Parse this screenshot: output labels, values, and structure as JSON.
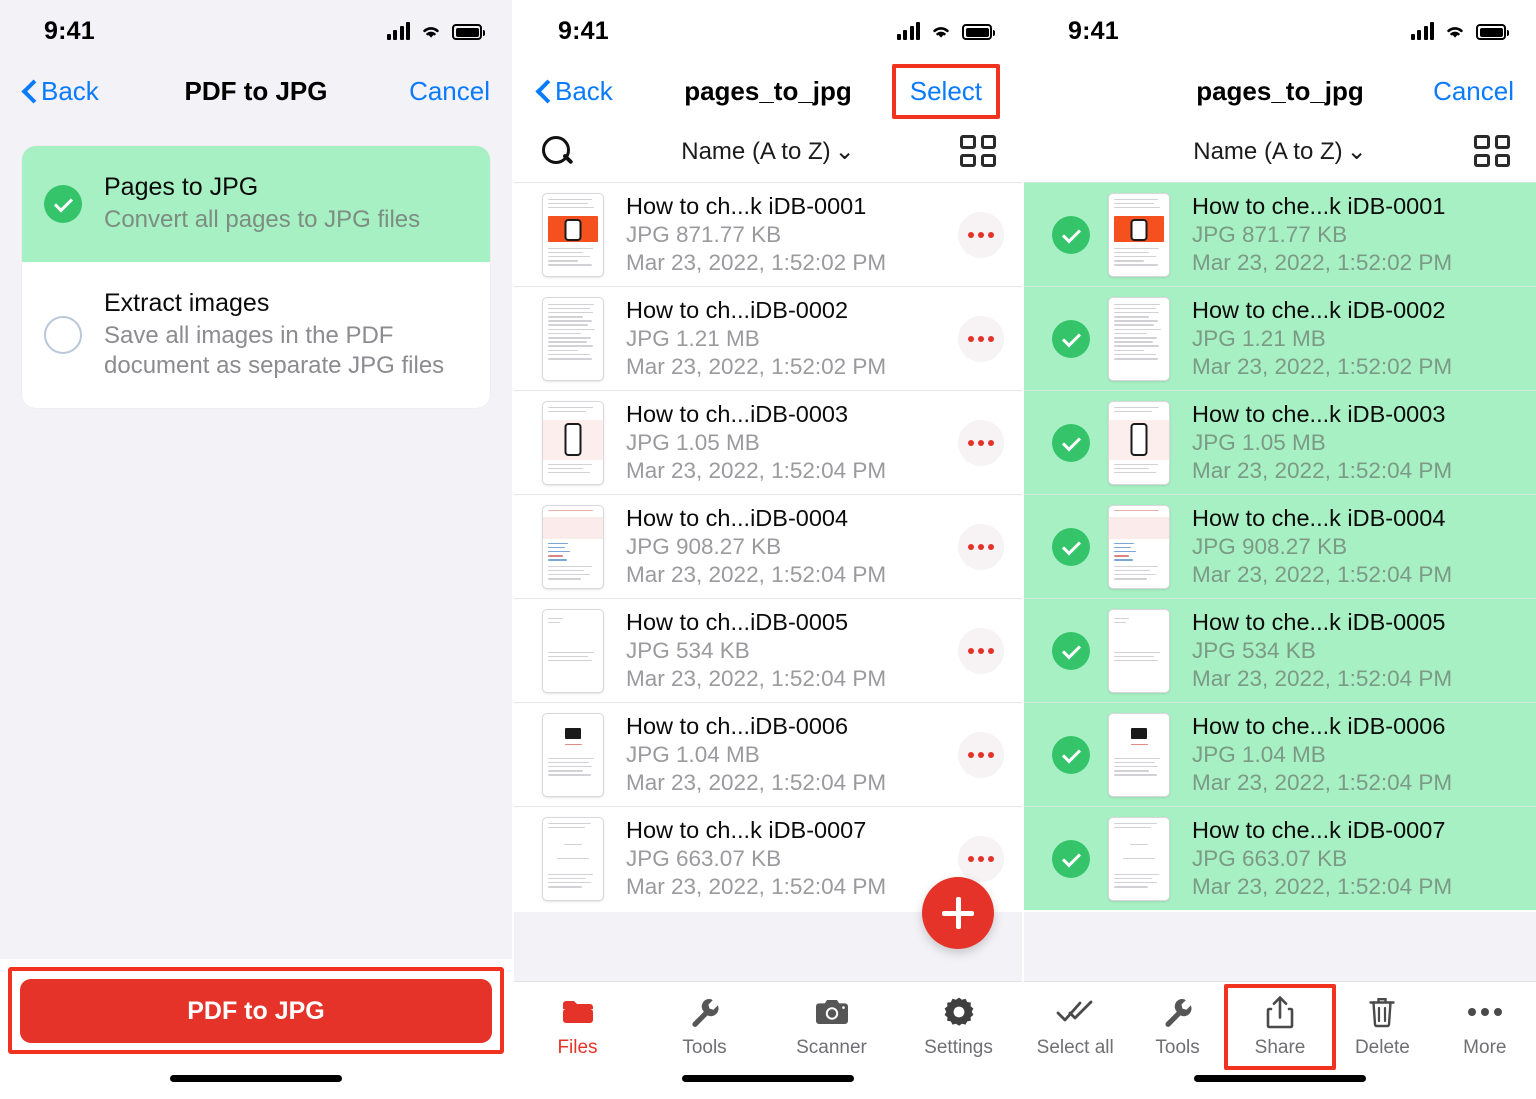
{
  "colors": {
    "accent_red": "#e5332a",
    "highlight_box": "#f0321e",
    "ios_blue": "#0a7bff",
    "select_green_bg": "#a7f0c3",
    "check_green": "#35c46a",
    "panel_bg": "#f2f2f7"
  },
  "status_bar": {
    "time": "9:41",
    "signal_icon": "cellular-bars-icon",
    "wifi_icon": "wifi-icon",
    "battery_icon": "battery-full-icon"
  },
  "panel1": {
    "nav": {
      "back_label": "Back",
      "title": "PDF to JPG",
      "right_label": "Cancel"
    },
    "options": [
      {
        "title": "Pages to JPG",
        "subtitle": "Convert all pages to JPG files",
        "selected": true
      },
      {
        "title": "Extract images",
        "subtitle": "Save all images in the PDF document as separate JPG files",
        "selected": false
      }
    ],
    "cta_label": "PDF to JPG"
  },
  "panel2": {
    "nav": {
      "back_label": "Back",
      "title": "pages_to_jpg",
      "right_label": "Select",
      "right_highlighted": true
    },
    "toolbar": {
      "search_icon": "search-icon",
      "sort_label": "Name (A to Z)",
      "sort_chevron": "⌄",
      "grid_icon": "grid-view-icon"
    },
    "files": [
      {
        "name": "How to ch...k iDB-0001",
        "meta": "JPG 871.77 KB",
        "date": "Mar 23, 2022, 1:52:02 PM"
      },
      {
        "name": "How to ch...iDB-0002",
        "meta": "JPG 1.21 MB",
        "date": "Mar 23, 2022, 1:52:02 PM"
      },
      {
        "name": "How to ch...iDB-0003",
        "meta": "JPG 1.05 MB",
        "date": "Mar 23, 2022, 1:52:04 PM"
      },
      {
        "name": "How to ch...iDB-0004",
        "meta": "JPG 908.27 KB",
        "date": "Mar 23, 2022, 1:52:04 PM"
      },
      {
        "name": "How to ch...iDB-0005",
        "meta": "JPG 534 KB",
        "date": "Mar 23, 2022, 1:52:04 PM"
      },
      {
        "name": "How to ch...iDB-0006",
        "meta": "JPG 1.04 MB",
        "date": "Mar 23, 2022, 1:52:04 PM"
      },
      {
        "name": "How to ch...k iDB-0007",
        "meta": "JPG 663.07 KB",
        "date": "Mar 23, 2022, 1:52:04 PM"
      }
    ],
    "fab_icon": "add-plus-icon",
    "tabs": [
      {
        "label": "Files",
        "icon": "folder-icon",
        "active": true
      },
      {
        "label": "Tools",
        "icon": "wrench-icon",
        "active": false
      },
      {
        "label": "Scanner",
        "icon": "camera-icon",
        "active": false
      },
      {
        "label": "Settings",
        "icon": "gear-icon",
        "active": false
      }
    ]
  },
  "panel3": {
    "nav": {
      "title": "pages_to_jpg",
      "right_label": "Cancel"
    },
    "toolbar": {
      "sort_label": "Name (A to Z)",
      "sort_chevron": "⌄",
      "grid_icon": "grid-view-icon"
    },
    "files": [
      {
        "name": "How to che...k iDB-0001",
        "meta": "JPG 871.77 KB",
        "date": "Mar 23, 2022, 1:52:02 PM",
        "selected": true
      },
      {
        "name": "How to che...k iDB-0002",
        "meta": "JPG 1.21 MB",
        "date": "Mar 23, 2022, 1:52:02 PM",
        "selected": true
      },
      {
        "name": "How to che...k iDB-0003",
        "meta": "JPG 1.05 MB",
        "date": "Mar 23, 2022, 1:52:04 PM",
        "selected": true
      },
      {
        "name": "How to che...k iDB-0004",
        "meta": "JPG 908.27 KB",
        "date": "Mar 23, 2022, 1:52:04 PM",
        "selected": true
      },
      {
        "name": "How to che...k iDB-0005",
        "meta": "JPG 534 KB",
        "date": "Mar 23, 2022, 1:52:04 PM",
        "selected": true
      },
      {
        "name": "How to che...k iDB-0006",
        "meta": "JPG 1.04 MB",
        "date": "Mar 23, 2022, 1:52:04 PM",
        "selected": true
      },
      {
        "name": "How to che...k iDB-0007",
        "meta": "JPG 663.07 KB",
        "date": "Mar 23, 2022, 1:52:04 PM",
        "selected": true
      }
    ],
    "tabs": [
      {
        "label": "Select all",
        "icon": "double-check-icon",
        "highlighted": false
      },
      {
        "label": "Tools",
        "icon": "wrench-icon",
        "highlighted": false
      },
      {
        "label": "Share",
        "icon": "share-upload-icon",
        "highlighted": true
      },
      {
        "label": "Delete",
        "icon": "trash-icon",
        "highlighted": false
      },
      {
        "label": "More",
        "icon": "ellipsis-icon",
        "highlighted": false
      }
    ]
  }
}
